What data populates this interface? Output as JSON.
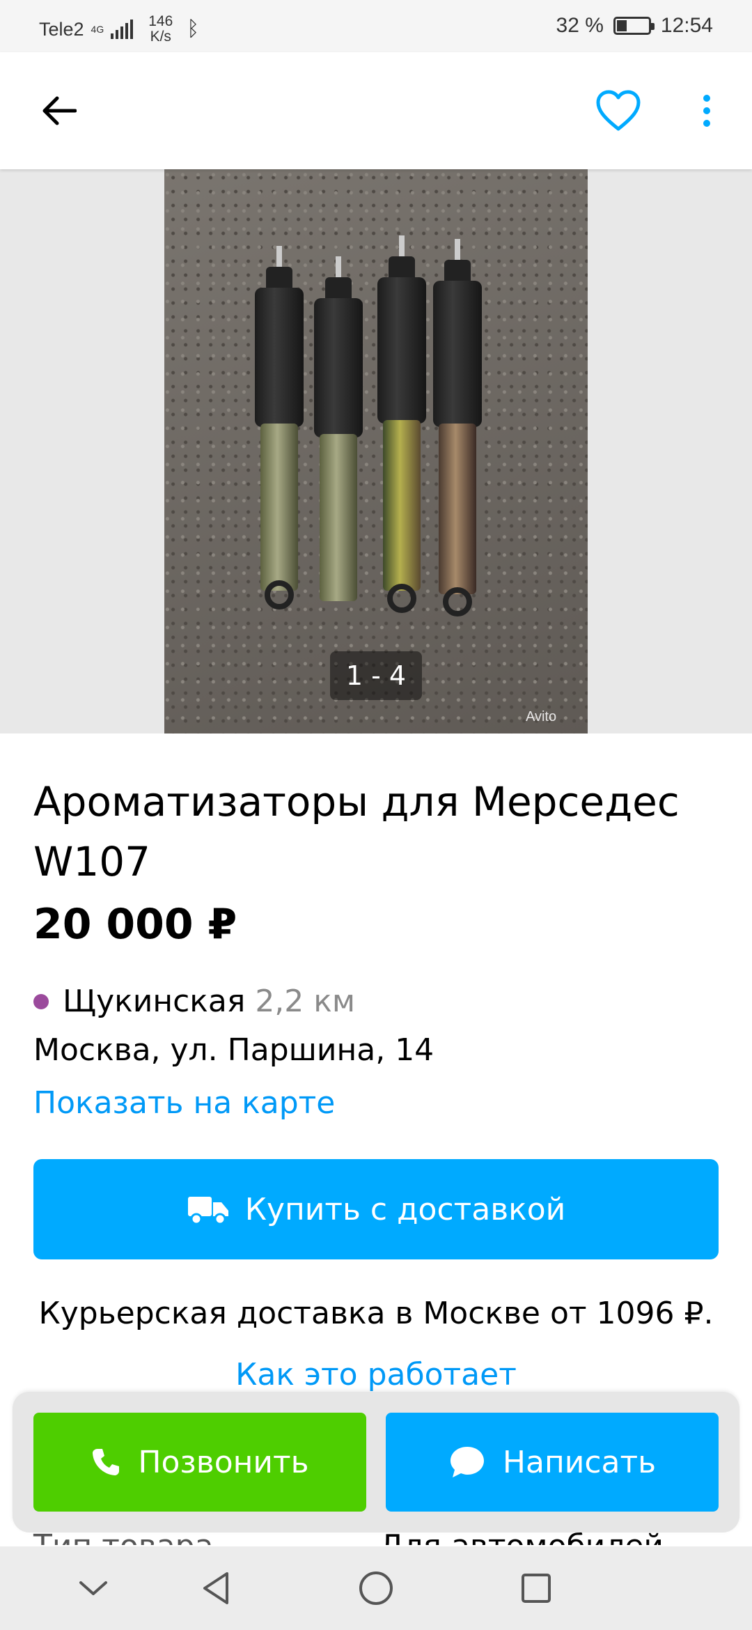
{
  "status_bar": {
    "carrier": "Tele2",
    "network": "4G",
    "speed_value": "146",
    "speed_unit": "K/s",
    "battery": "32 %",
    "time": "12:54"
  },
  "gallery": {
    "counter": "1 - 4",
    "watermark": "Avito"
  },
  "listing": {
    "title": "Ароматизаторы для Мерседес W107",
    "price": "20 000 ₽",
    "metro_station": "Щукинская",
    "metro_distance": "2,2 км",
    "metro_line_color": "#9b4a9c",
    "address": "Москва, ул. Паршина, 14",
    "map_link": "Показать на карте",
    "buy_button": "Купить с доставкой",
    "delivery_text": "Курьерская доставка в Москве от 1096 ₽.",
    "how_link": "Как это работает",
    "param_label": "Тип товара",
    "param_value": "Для автомобилей"
  },
  "actions": {
    "call": "Позвонить",
    "write": "Написать"
  },
  "colors": {
    "accent": "#00aaff",
    "link": "#0099f7",
    "call_green": "#4ece00"
  },
  "icons": [
    "back-arrow-icon",
    "heart-icon",
    "more-vertical-icon",
    "truck-icon",
    "phone-icon",
    "chat-bubble-icon",
    "nav-collapse-icon",
    "nav-back-icon",
    "nav-home-icon",
    "nav-recents-icon"
  ]
}
